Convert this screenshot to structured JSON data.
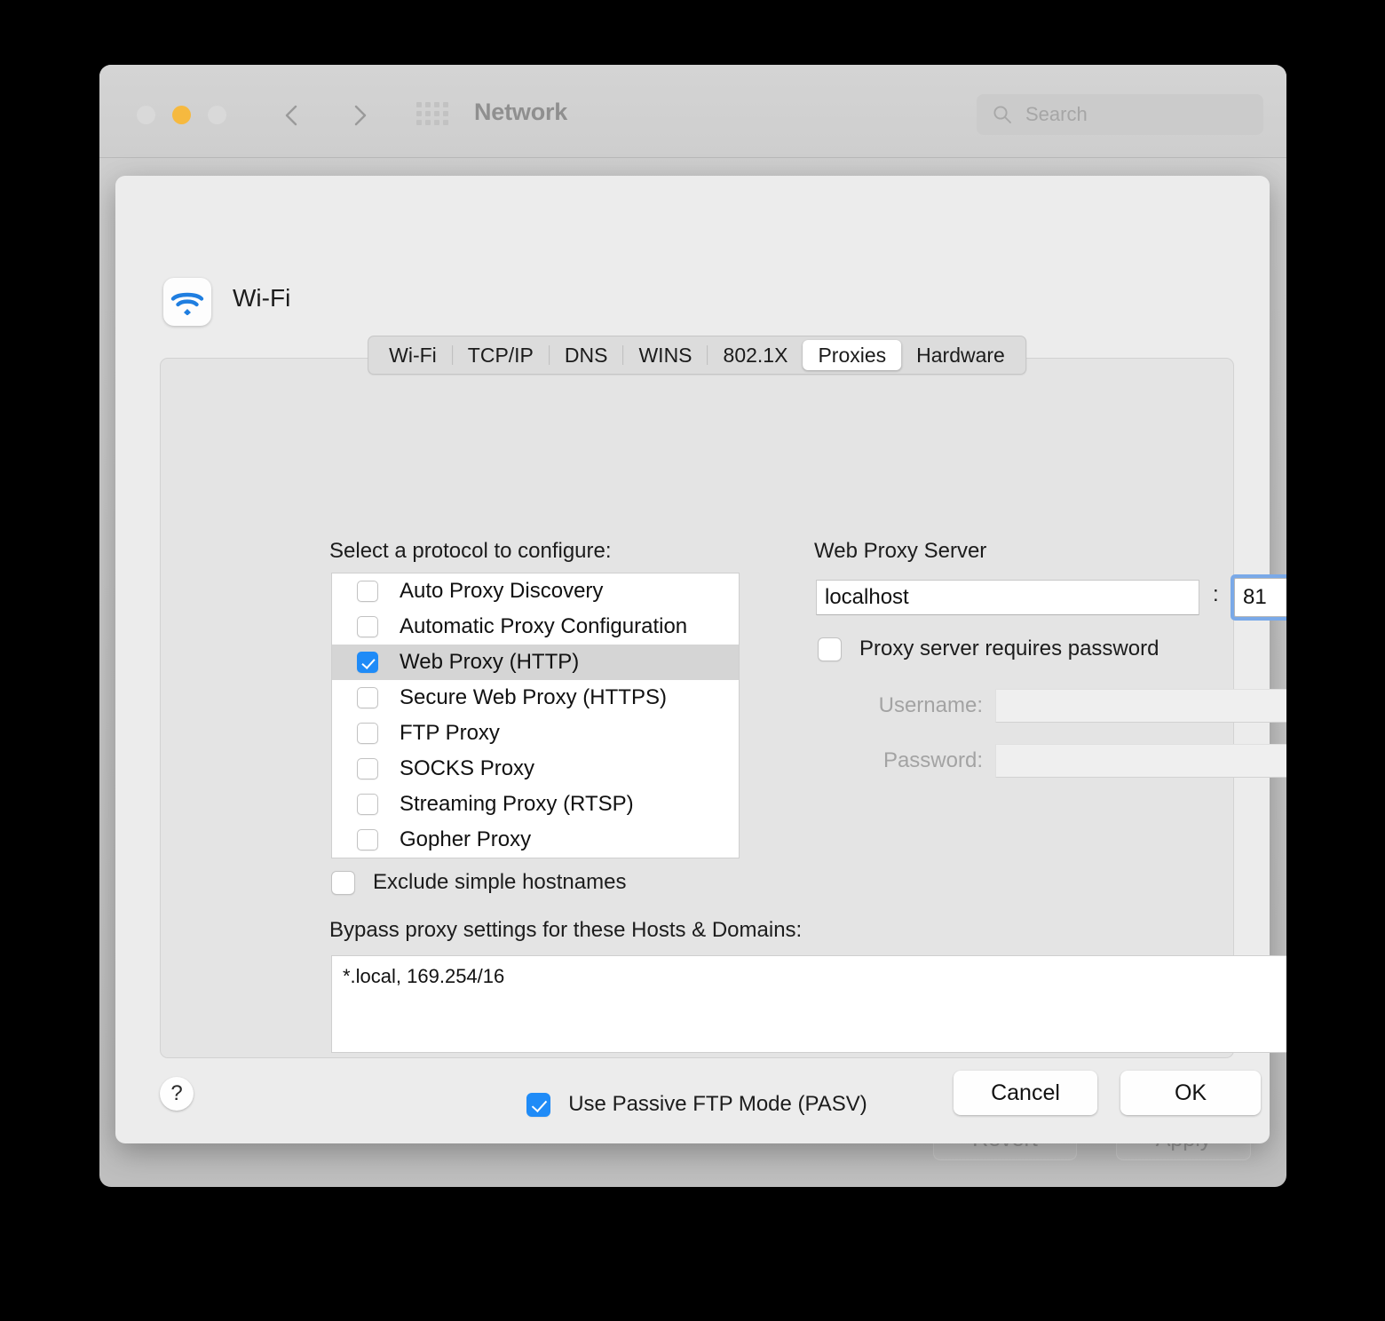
{
  "window": {
    "title": "Network",
    "traffic_lights": [
      "close",
      "minimize",
      "maximize"
    ],
    "search": {
      "placeholder": "Search",
      "value": ""
    },
    "footer": {
      "revert_label": "Revert",
      "apply_label": "Apply"
    }
  },
  "sheet": {
    "interface_name": "Wi-Fi",
    "interface_icon": "wifi-icon",
    "tabs": [
      {
        "label": "Wi-Fi",
        "active": false
      },
      {
        "label": "TCP/IP",
        "active": false
      },
      {
        "label": "DNS",
        "active": false
      },
      {
        "label": "WINS",
        "active": false
      },
      {
        "label": "802.1X",
        "active": false
      },
      {
        "label": "Proxies",
        "active": true
      },
      {
        "label": "Hardware",
        "active": false
      }
    ],
    "left": {
      "heading": "Select a protocol to configure:",
      "protocols": [
        {
          "label": "Auto Proxy Discovery",
          "checked": false,
          "selected": false
        },
        {
          "label": "Automatic Proxy Configuration",
          "checked": false,
          "selected": false
        },
        {
          "label": "Web Proxy (HTTP)",
          "checked": true,
          "selected": true
        },
        {
          "label": "Secure Web Proxy (HTTPS)",
          "checked": false,
          "selected": false
        },
        {
          "label": "FTP Proxy",
          "checked": false,
          "selected": false
        },
        {
          "label": "SOCKS Proxy",
          "checked": false,
          "selected": false
        },
        {
          "label": "Streaming Proxy (RTSP)",
          "checked": false,
          "selected": false
        },
        {
          "label": "Gopher Proxy",
          "checked": false,
          "selected": false
        }
      ],
      "exclude_simple_hostnames": {
        "label": "Exclude simple hostnames",
        "checked": false
      },
      "bypass_label": "Bypass proxy settings for these Hosts & Domains:",
      "bypass_value": "*.local, 169.254/16"
    },
    "right": {
      "title": "Web Proxy Server",
      "host_value": "localhost",
      "colon": ":",
      "port_value": "81",
      "port_focused": true,
      "requires_password": {
        "label": "Proxy server requires password",
        "checked": false
      },
      "username_label": "Username:",
      "username_value": "",
      "password_label": "Password:",
      "password_value": ""
    },
    "pasv": {
      "label": "Use Passive FTP Mode (PASV)",
      "checked": true
    },
    "footer": {
      "help_label": "?",
      "cancel_label": "Cancel",
      "ok_label": "OK"
    }
  },
  "colors": {
    "accent": "#1f8bf7",
    "focus_ring": "#7aa9e8",
    "minimize": "#f6b93f",
    "sheet_bg": "#ececec",
    "panel_bg": "#e4e4e4"
  }
}
